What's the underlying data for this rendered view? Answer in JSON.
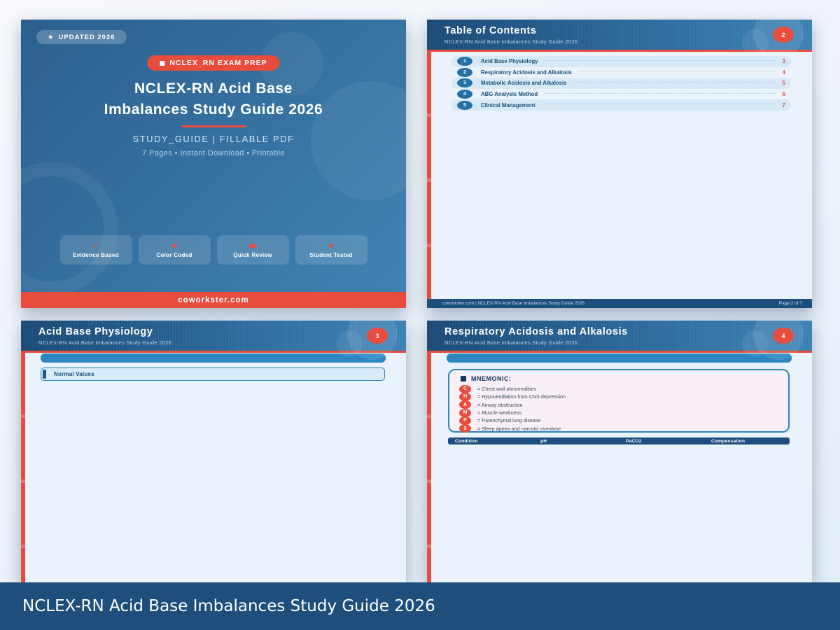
{
  "app_footer": {
    "title": "NCLEX-RN Acid Base Imbalances Study Guide 2026"
  },
  "colors": {
    "accent_red": "#e74c3c",
    "navy": "#1d4e7d",
    "blue": "#2e86c1",
    "page_bg": "#eaf3fb"
  },
  "cover": {
    "badge": {
      "icon": "★",
      "label": "UPDATED 2026"
    },
    "pill": {
      "label": "NCLEX_RN EXAM PREP"
    },
    "title_line1": "NCLEX-RN Acid Base",
    "title_line2": "Imbalances Study Guide 2026",
    "subtitle": "STUDY_GUIDE  |  FILLABLE PDF",
    "meta": "7 Pages  •  Instant Download  •  Printable",
    "features": [
      {
        "icon": "✓",
        "label": "Evidence Based"
      },
      {
        "icon": "★",
        "label": "Color Coded"
      },
      {
        "icon": "■",
        "label": "Quick Review"
      },
      {
        "icon": "♥",
        "label": "Student Tested"
      }
    ],
    "footer": "coworkster.com"
  },
  "toc_page": {
    "title": "Table of Contents",
    "subtitle": "NCLEX-RN Acid Base Imbalances Study Guide 2026",
    "page_badge": "2",
    "items": [
      {
        "num": "1",
        "label": "Acid Base Physiology",
        "page": "3"
      },
      {
        "num": "2",
        "label": "Respiratory Acidosis and Alkalosis",
        "page": "4"
      },
      {
        "num": "3",
        "label": "Metabolic Acidosis and Alkalosis",
        "page": "5"
      },
      {
        "num": "4",
        "label": "ABG Analysis Method",
        "page": "6"
      },
      {
        "num": "5",
        "label": "Clinical Management",
        "page": "7"
      }
    ],
    "footer_left": "coworkster.com  |  NCLEX-RN Acid Base Imbalances Study Guide 2026",
    "footer_right": "Page 2 of 7"
  },
  "physiology_page": {
    "title": "Acid Base Physiology",
    "subtitle": "NCLEX-RN Acid Base Imbalances Study Guide 2026",
    "page_badge": "3",
    "section_label": "Normal Values"
  },
  "respiratory_page": {
    "title": "Respiratory Acidosis and Alkalosis",
    "subtitle": "NCLEX-RN Acid Base Imbalances Study Guide 2026",
    "page_badge": "4",
    "mnemonic_title": "MNEMONIC:",
    "mnemonic_items": [
      {
        "letter": "C",
        "text": "= Chest wall abnormalities"
      },
      {
        "letter": "H",
        "text": "= Hypoventilation from CNS depression"
      },
      {
        "letter": "A",
        "text": "= Airway obstruction"
      },
      {
        "letter": "M",
        "text": "= Muscle weakness"
      },
      {
        "letter": "P",
        "text": "= Parenchymal lung disease"
      },
      {
        "letter": "S",
        "text": "= Sleep apnea and narcotic overdose"
      }
    ],
    "table_headers": [
      "Condition",
      "pH",
      "PaCO2",
      "Compensation"
    ]
  }
}
